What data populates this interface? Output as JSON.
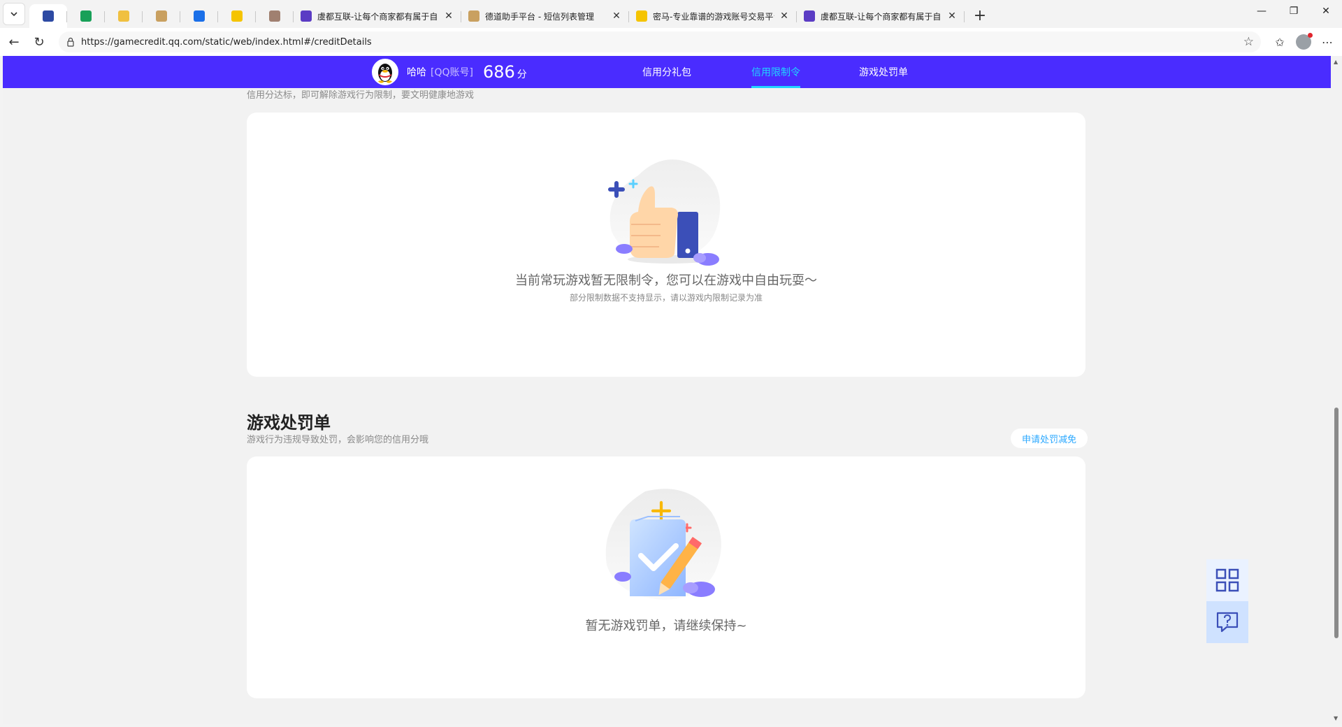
{
  "browser": {
    "tabs": [
      {
        "type": "pinned",
        "icon": "shield-icon",
        "color": "#2d4aa3",
        "active": true
      },
      {
        "type": "pinned",
        "icon": "green-circle-icon",
        "color": "#18a058"
      },
      {
        "type": "pinned",
        "icon": "sparkle-icon",
        "color": "#f0c040"
      },
      {
        "type": "pinned",
        "icon": "pet-icon",
        "color": "#c9a060"
      },
      {
        "type": "pinned",
        "icon": "vpn-shield-icon",
        "color": "#1a6fe8"
      },
      {
        "type": "pinned",
        "icon": "yellow-app-icon",
        "color": "#f5c400"
      },
      {
        "type": "pinned",
        "icon": "cat-icon",
        "color": "#a08070"
      },
      {
        "type": "wide",
        "label": "虞都互联-让每个商家都有属于自己",
        "icon": "hudu-logo-icon",
        "color": "#5b3cc4"
      },
      {
        "type": "wide",
        "label": "德道助手平台 - 短信列表管理",
        "icon": "dedao-icon",
        "color": "#c9a060"
      },
      {
        "type": "wide",
        "label": "密马-专业靠谱的游戏账号交易平台",
        "icon": "mima-icon",
        "color": "#f5c400"
      },
      {
        "type": "wide",
        "label": "虞都互联-让每个商家都有属于自己",
        "icon": "hudu-logo-icon",
        "color": "#5b3cc4"
      }
    ],
    "url": "https://gamecredit.qq.com/static/web/index.html#/creditDetails"
  },
  "header": {
    "username": "哈哈",
    "account_type": "[QQ账号]",
    "score": "686",
    "score_unit": "分",
    "nav": [
      {
        "label": "信用分礼包",
        "active": false
      },
      {
        "label": "信用限制令",
        "active": true
      },
      {
        "label": "游戏处罚单",
        "active": false
      }
    ]
  },
  "restrictions": {
    "subtitle": "信用分达标，即可解除游戏行为限制，要文明健康地游戏",
    "empty_title": "当前常玩游戏暂无限制令，您可以在游戏中自由玩耍～",
    "empty_note": "部分限制数据不支持显示，请以游戏内限制记录为准"
  },
  "penalties": {
    "title": "游戏处罚单",
    "subtitle": "游戏行为违规导致处罚，会影响您的信用分哦",
    "appeal_button": "申请处罚减免",
    "empty_title": "暂无游戏罚单，请继续保持~"
  },
  "colors": {
    "header_bg": "#4a2cff",
    "active_nav": "#21d4ff",
    "link": "#2aa8ff"
  }
}
